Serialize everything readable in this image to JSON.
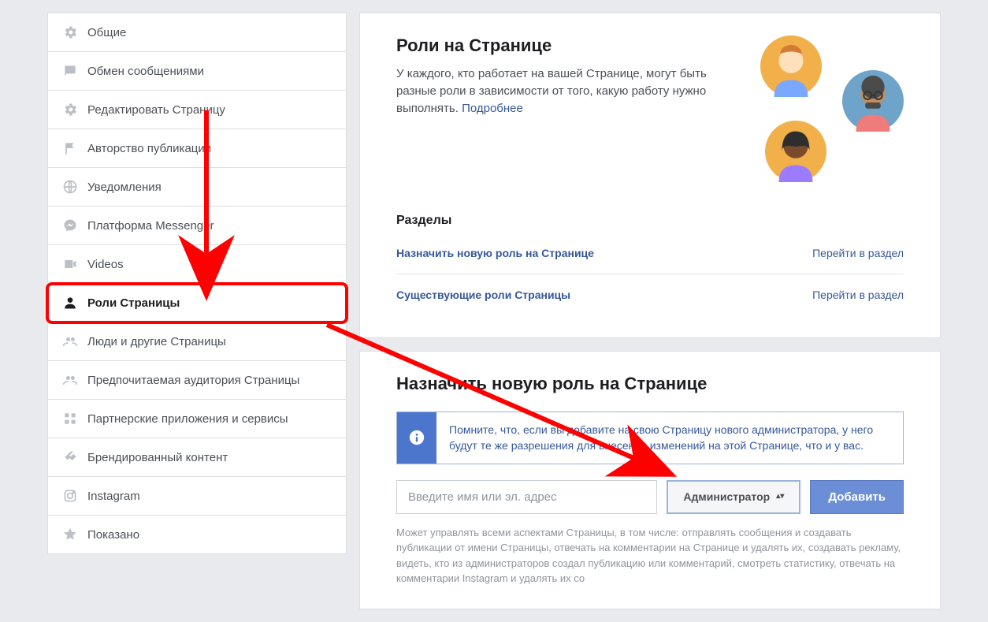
{
  "sidebar": {
    "items": [
      {
        "label": "Общие",
        "icon": "gear"
      },
      {
        "label": "Обмен сообщениями",
        "icon": "chat"
      },
      {
        "label": "Редактировать Страницу",
        "icon": "gear"
      },
      {
        "label": "Авторство публикации",
        "icon": "flag"
      },
      {
        "label": "Уведомления",
        "icon": "globe"
      },
      {
        "label": "Платформа Messenger",
        "icon": "messenger"
      },
      {
        "label": "Videos",
        "icon": "video"
      },
      {
        "label": "Роли Страницы",
        "icon": "person"
      },
      {
        "label": "Люди и другие Страницы",
        "icon": "people-ghost"
      },
      {
        "label": "Предпочитаемая аудитория Страницы",
        "icon": "people-ghost"
      },
      {
        "label": "Партнерские приложения и сервисы",
        "icon": "apps"
      },
      {
        "label": "Брендированный контент",
        "icon": "handshake"
      },
      {
        "label": "Instagram",
        "icon": "instagram"
      },
      {
        "label": "Показано",
        "icon": "star"
      }
    ]
  },
  "main": {
    "title": "Роли на Странице",
    "intro": "У каждого, кто работает на вашей Странице, могут быть разные роли в зависимости от того, какую работу нужно выполнять.",
    "learn_more": "Подробнее",
    "sections_title": "Разделы",
    "section_links": [
      {
        "label": "Назначить новую роль на Странице",
        "goto": "Перейти в раздел"
      },
      {
        "label": "Существующие роли Страницы",
        "goto": "Перейти в раздел"
      }
    ],
    "assign": {
      "title": "Назначить новую роль на Странице",
      "info": "Помните, что, если вы добавите на свою Страницу нового администратора, у него будут те же разрешения для внесения изменений на этой Странице, что и у вас.",
      "input_placeholder": "Введите имя или эл. адрес",
      "role_selected": "Администратор",
      "add_button": "Добавить",
      "role_description": "Может управлять всеми аспектами Страницы, в том числе: отправлять сообщения и создавать публикации от имени Страницы, отвечать на комментарии на Странице и удалять их, создавать рекламу, видеть, кто из администраторов создал публикацию или комментарий, смотреть статистику, отвечать на комментарии Instagram и удалять их со"
    }
  }
}
